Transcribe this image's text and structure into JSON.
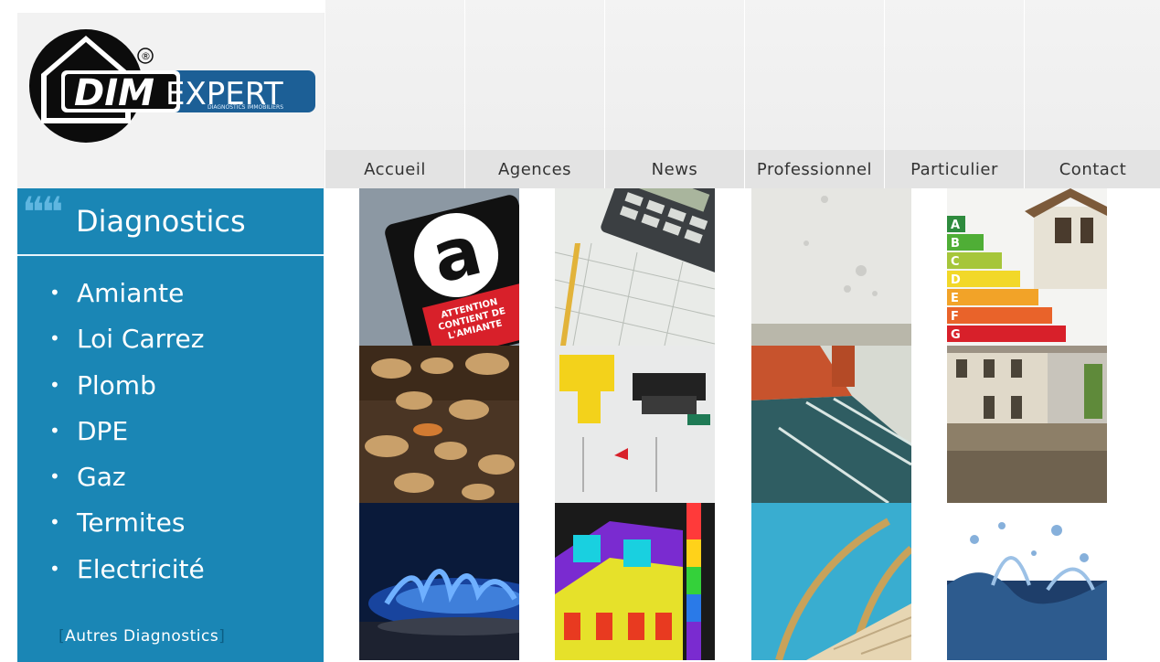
{
  "logo": {
    "brand_left": "DIM",
    "brand_right": "EXPERT",
    "tagline": "DIAGNOSTICS IMMOBILIERS",
    "registered": "®"
  },
  "nav": {
    "items": [
      {
        "label": "Accueil"
      },
      {
        "label": "Agences"
      },
      {
        "label": "News"
      },
      {
        "label": "Professionnel"
      },
      {
        "label": "Particulier"
      },
      {
        "label": "Contact"
      }
    ]
  },
  "sidebar": {
    "title": "Diagnostics",
    "items": [
      {
        "label": "Amiante"
      },
      {
        "label": "Loi Carrez"
      },
      {
        "label": "Plomb"
      },
      {
        "label": "DPE"
      },
      {
        "label": "Gaz"
      },
      {
        "label": "Termites"
      },
      {
        "label": "Electricité"
      }
    ],
    "other_link": "Autres Diagnostics",
    "bullet": "•"
  },
  "tiles": {
    "amiante_letter": "a",
    "amiante_line1": "ATTENTION",
    "amiante_line2": "CONTIENT DE",
    "amiante_line3": "L'AMIANTE",
    "energy_labels": [
      "A",
      "B",
      "C",
      "D",
      "E",
      "F",
      "G"
    ]
  },
  "colors": {
    "sidebar_blue": "#1a86b5",
    "nav_text": "#333333",
    "logo_blue": "#1c5f96"
  }
}
